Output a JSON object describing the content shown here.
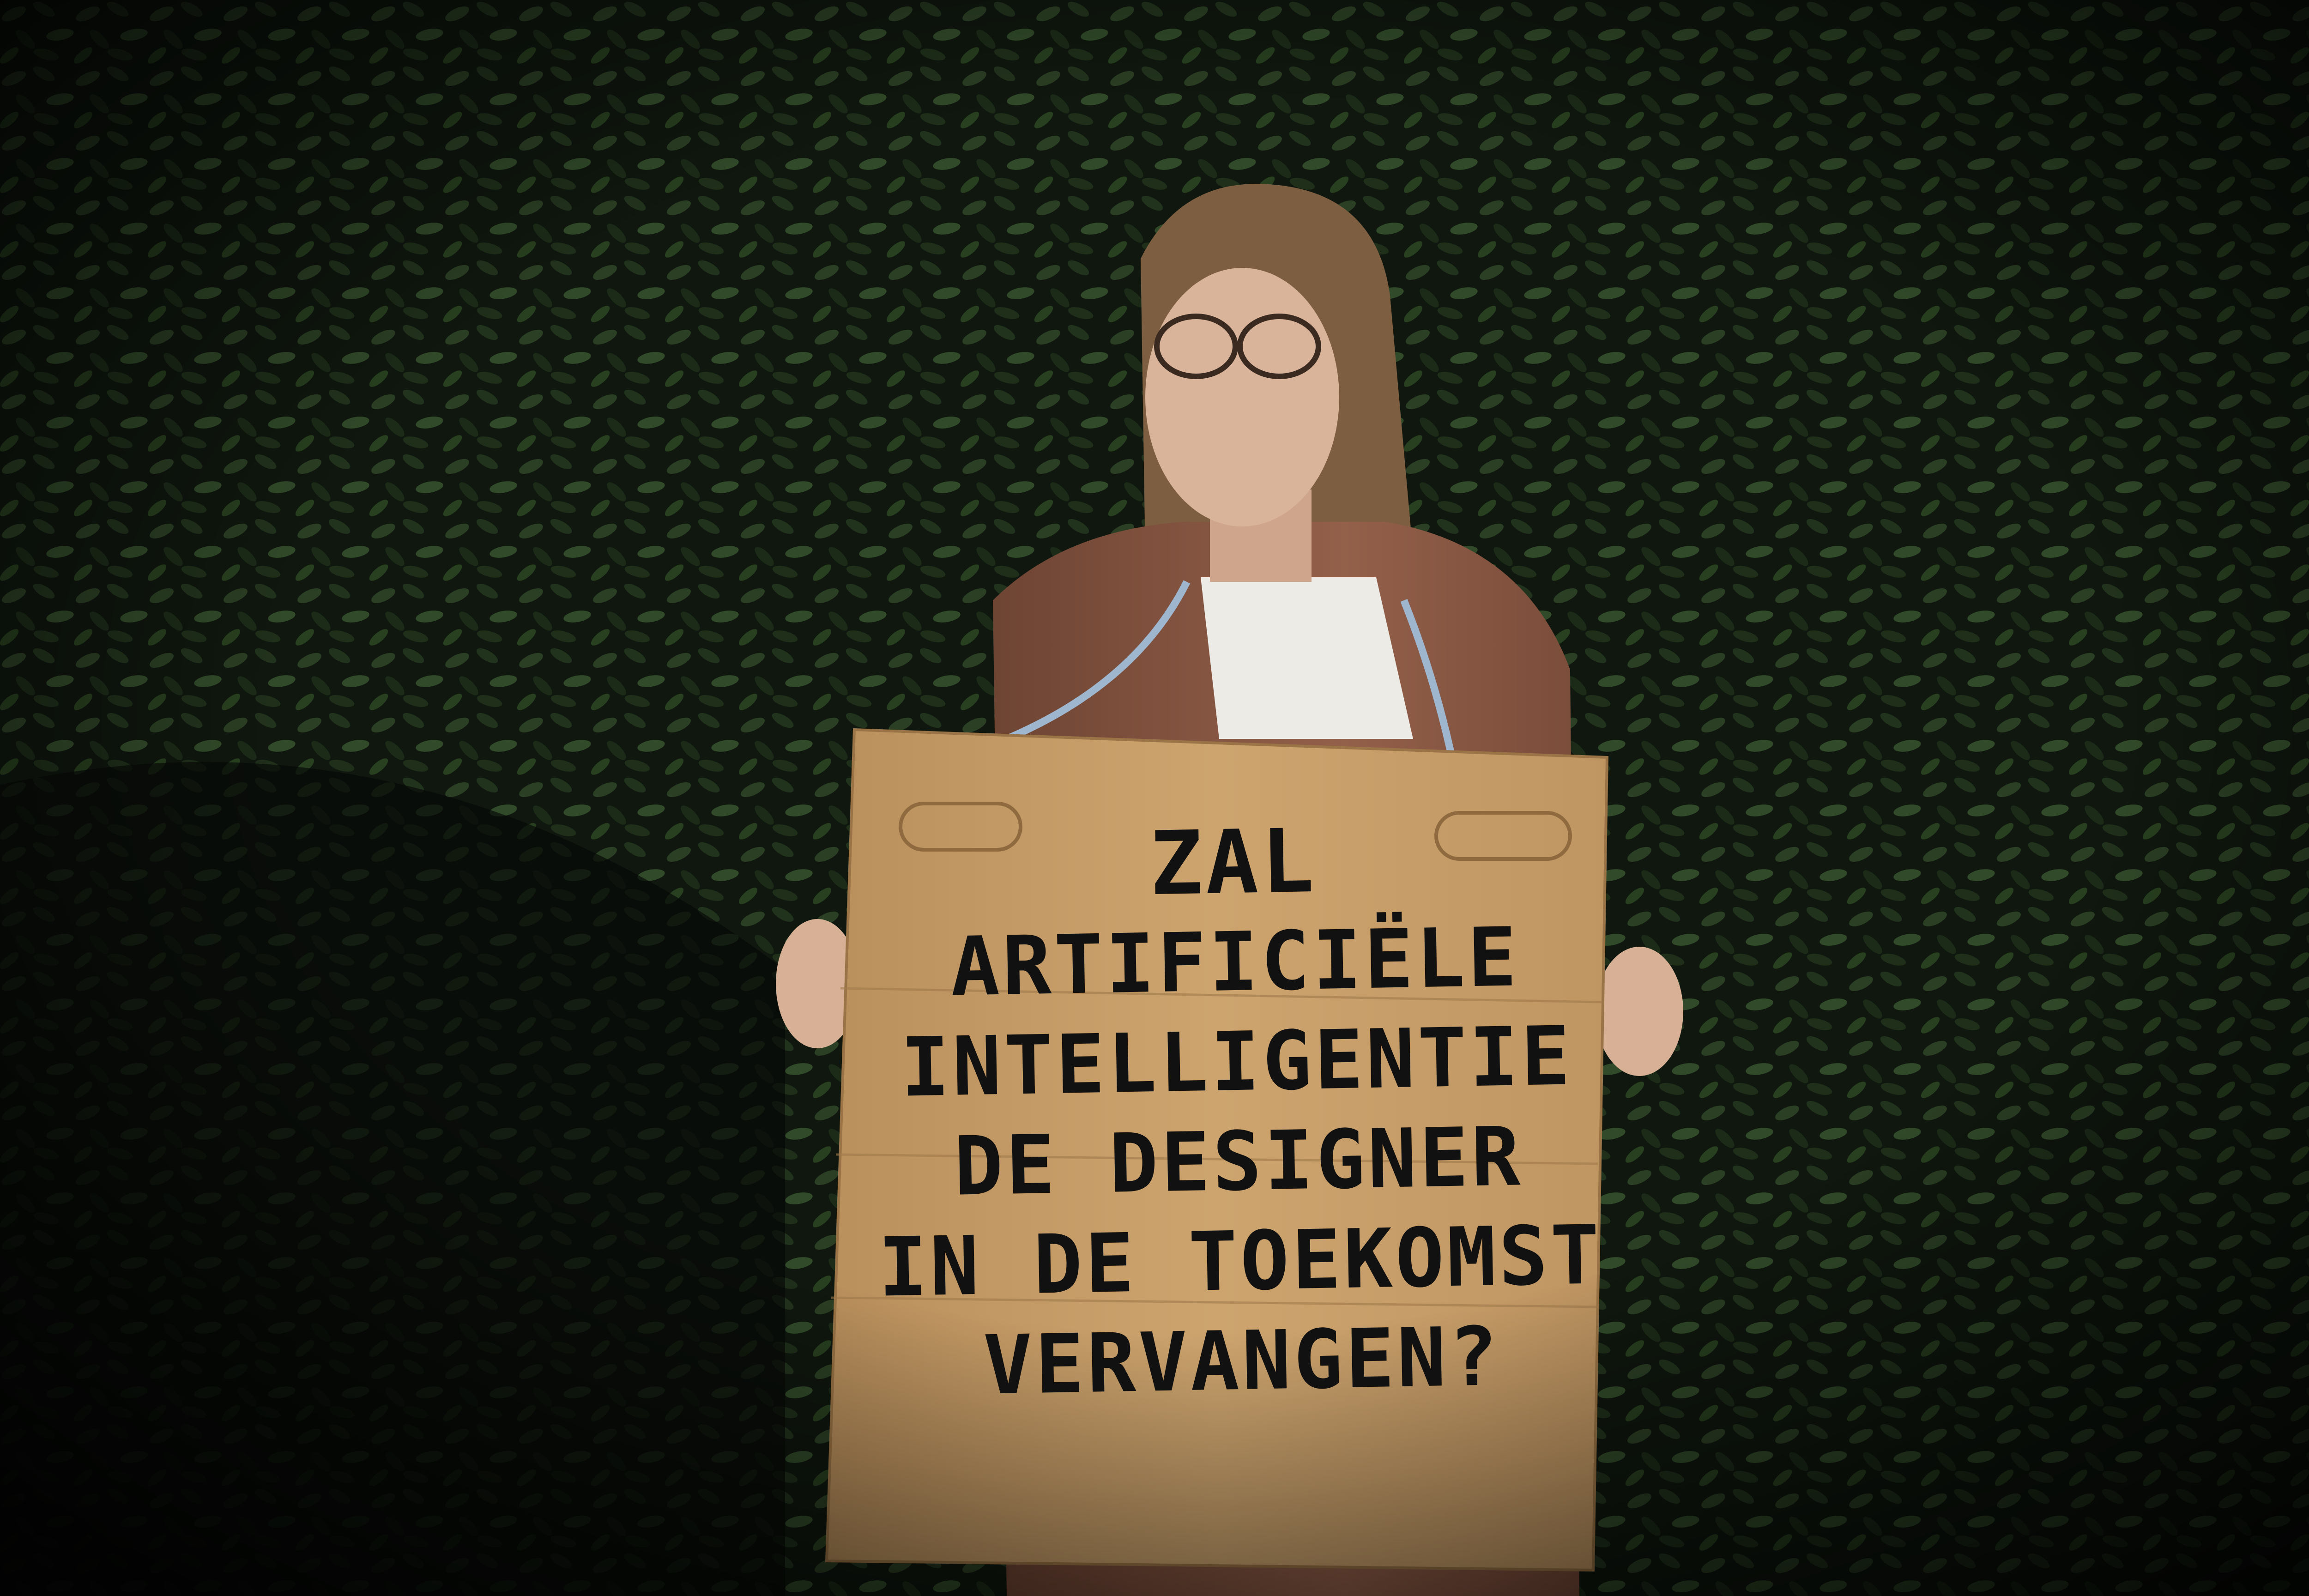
{
  "photo": {
    "sign": {
      "lines": [
        "ZAL",
        "ARTIFICIËLE",
        "INTELLIGENTIE",
        "DE DESIGNER",
        "IN DE TOEKOMST",
        "VERVANGEN?"
      ]
    },
    "colors": {
      "foliage_dark": "#0e140d",
      "foliage_light": "#2f4427",
      "cardboard": "#c9a06a",
      "jacket": "#8a5a44",
      "blouse": "#ecebe6",
      "hair": "#8a6a4a",
      "skin": "#d9b39a"
    }
  }
}
